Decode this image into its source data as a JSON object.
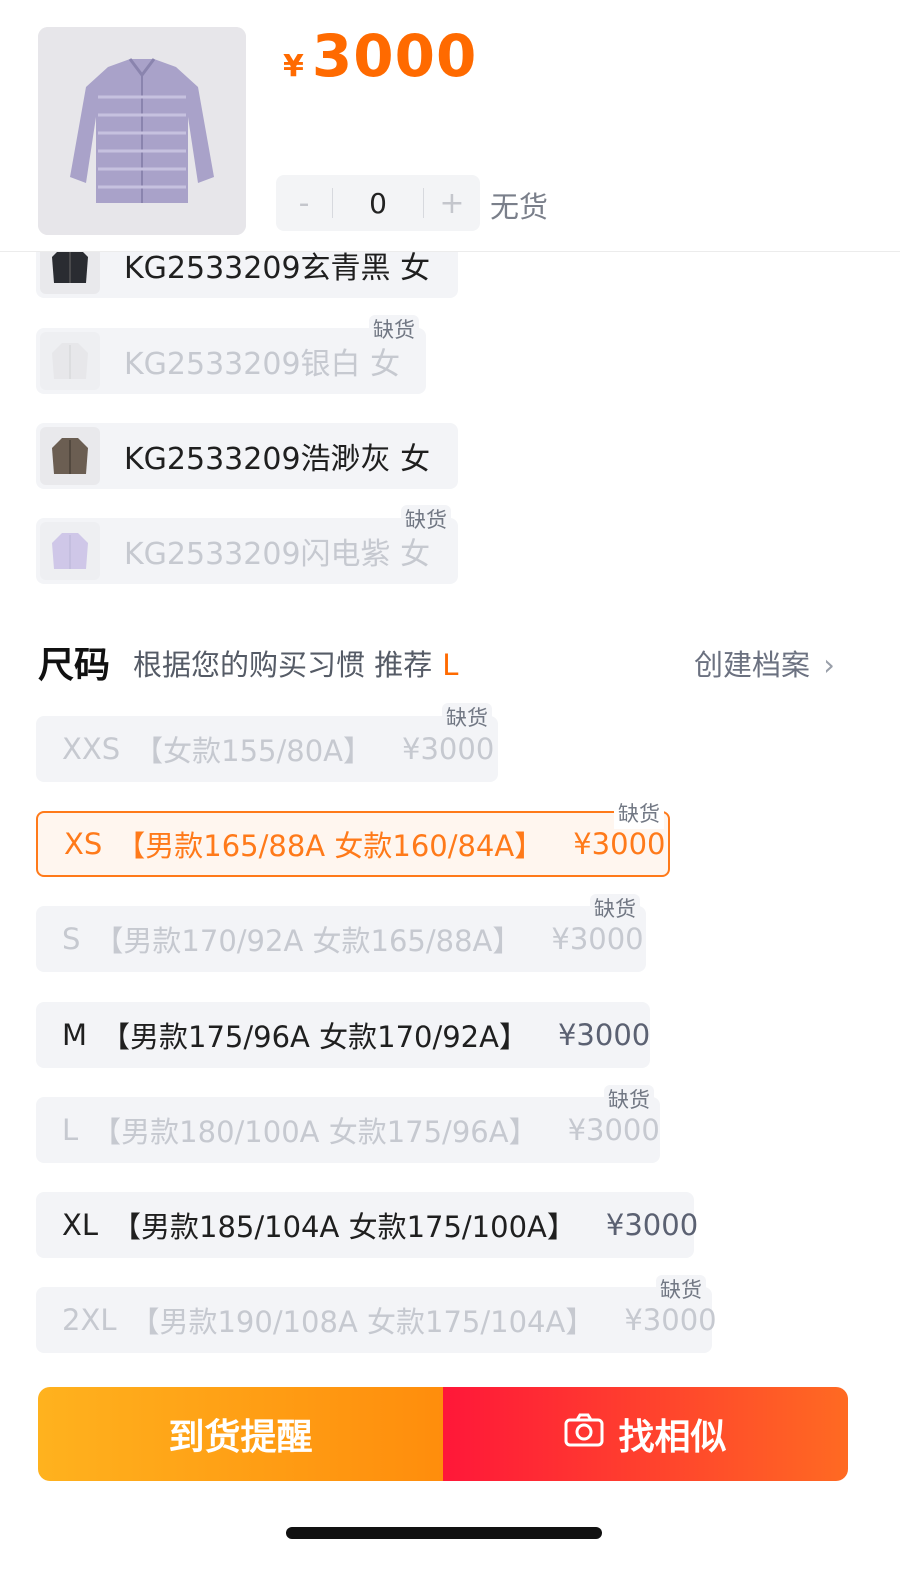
{
  "header": {
    "currency": "¥",
    "price": "3000",
    "stepper": {
      "minus": "-",
      "qty": "0",
      "plus": "+"
    },
    "stock_status": "无货"
  },
  "colors": [
    {
      "label": "KG2533209玄青黑 女",
      "sold_out": false,
      "swatch": "#2a2c31"
    },
    {
      "label": "KG2533209银白 女",
      "sold_out": true,
      "swatch": "#e4e4e6",
      "sold_tag": "缺货"
    },
    {
      "label": "KG2533209浩渺灰 女",
      "sold_out": false,
      "swatch": "#6b5e52"
    },
    {
      "label": "KG2533209闪电紫 女",
      "sold_out": true,
      "swatch": "#a492d6",
      "sold_tag": "缺货"
    }
  ],
  "size_section": {
    "title": "尺码",
    "recommend_text": "根据您的购买习惯 推荐",
    "recommend_size": "L",
    "profile_link": "创建档案",
    "options": [
      {
        "code": "XXS",
        "desc": "【女款155/80A】",
        "price": "¥3000",
        "state": "disabled",
        "sold_tag": "缺货"
      },
      {
        "code": "XS",
        "desc": "【男款165/88A 女款160/84A】",
        "price": "¥3000",
        "state": "selected",
        "sold_tag": "缺货"
      },
      {
        "code": "S",
        "desc": "【男款170/92A 女款165/88A】",
        "price": "¥3000",
        "state": "disabled",
        "sold_tag": "缺货"
      },
      {
        "code": "M",
        "desc": "【男款175/96A 女款170/92A】",
        "price": "¥3000",
        "state": "available"
      },
      {
        "code": "L",
        "desc": "【男款180/100A 女款175/96A】",
        "price": "¥3000",
        "state": "disabled",
        "sold_tag": "缺货"
      },
      {
        "code": "XL",
        "desc": "【男款185/104A 女款175/100A】",
        "price": "¥3000",
        "state": "available"
      },
      {
        "code": "2XL",
        "desc": "【男款190/108A 女款175/104A】",
        "price": "¥3000",
        "state": "disabled",
        "sold_tag": "缺货"
      }
    ]
  },
  "actions": {
    "notify_label": "到货提醒",
    "similar_label": "找相似"
  },
  "theme": {
    "accent": "#ff6a00",
    "notify_gradient": [
      "#ffb21e",
      "#ff8d0c"
    ],
    "similar_gradient": [
      "#ff1739",
      "#ff6a22"
    ]
  }
}
